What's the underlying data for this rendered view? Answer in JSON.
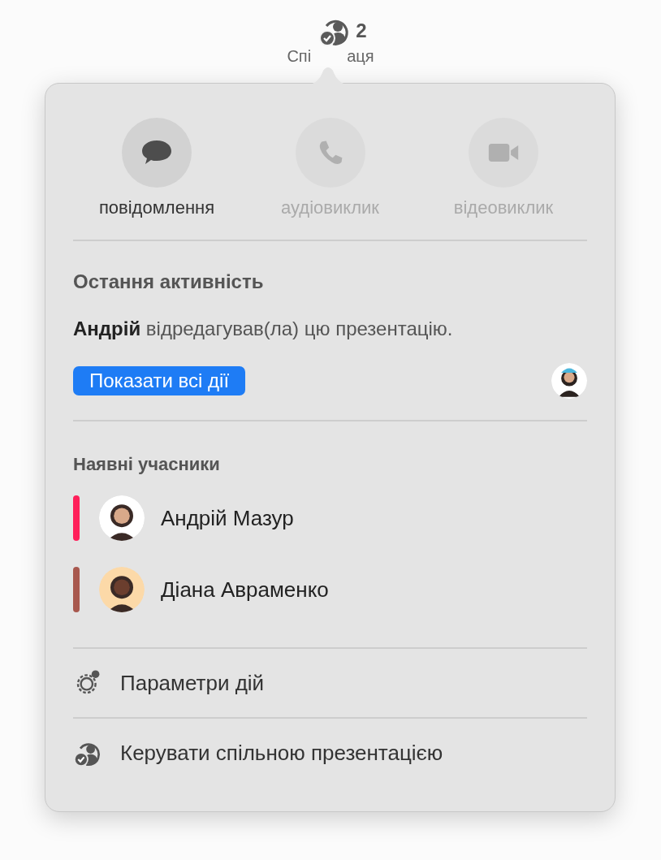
{
  "toolbar": {
    "count": "2",
    "label_parts": [
      "Спі",
      "аця"
    ]
  },
  "actions": [
    {
      "kind": "message",
      "label": "повідомлення",
      "disabled": false
    },
    {
      "kind": "audio",
      "label": "аудіовиклик",
      "disabled": true
    },
    {
      "kind": "video",
      "label": "відеовиклик",
      "disabled": true
    }
  ],
  "recent": {
    "heading": "Остання активність",
    "name": "Андрій",
    "text": "відредагував(ла) цю презентацію.",
    "button": "Показати всі дії"
  },
  "participants": {
    "heading": "Наявні учасники",
    "items": [
      {
        "name": "Андрій Мазур",
        "color": "#ff1f5a"
      },
      {
        "name": "Діана Авраменко",
        "color": "#a8584e"
      }
    ]
  },
  "menu": [
    {
      "kind": "settings",
      "label": "Параметри дій"
    },
    {
      "kind": "manage",
      "label": "Керувати спільною презентацією"
    }
  ]
}
